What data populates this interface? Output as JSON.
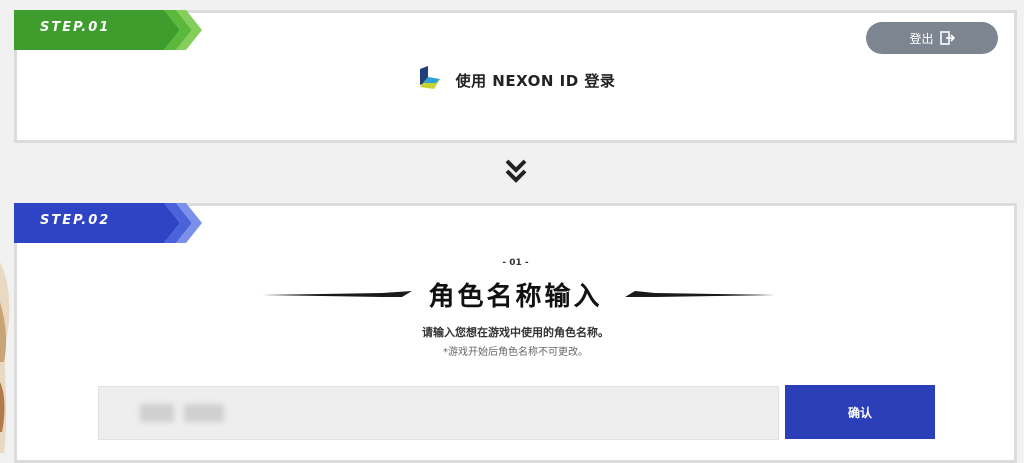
{
  "step1": {
    "label": "STEP.01",
    "logout_label": "登出",
    "login_text": "使用 NEXON ID 登录",
    "colors": {
      "ribbon": "#3a9b2c",
      "logout_bg": "#7d8591"
    }
  },
  "step2": {
    "label": "STEP.02",
    "sub_step": "- 01 -",
    "title": "角色名称输入",
    "description": "请输入您想在游戏中使用的角色名称。",
    "note": "*游戏开始后角色名称不可更改。",
    "confirm_label": "确认",
    "colors": {
      "ribbon": "#2f46c6",
      "confirm_bg": "#2b3fb8"
    }
  },
  "icons": [
    "nexon-logo-icon",
    "logout-icon",
    "double-chevron-down-icon"
  ]
}
